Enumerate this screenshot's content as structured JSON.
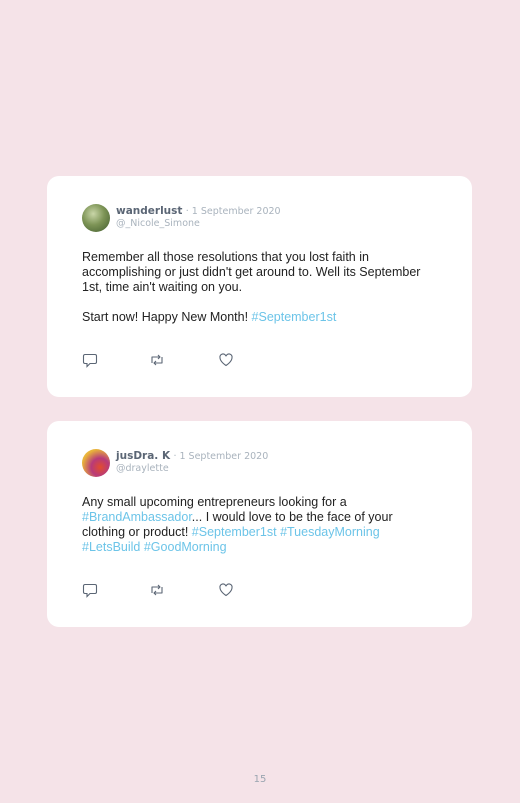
{
  "posts": [
    {
      "name": "wanderlust",
      "date": "· 1 September 2020",
      "handle": "@_Nicole_Simone",
      "paragraph1": "Remember all those resolutions that you lost faith in accomplishing or just didn't get around to. Well its September 1st, time ain't waiting on you.",
      "paragraph2_text": "Start now! Happy New Month! ",
      "paragraph2_tag": "#September1st"
    },
    {
      "name": "jusDra. K",
      "date": "· 1 September 2020",
      "handle": "@draylette",
      "text1": "Any small upcoming entrepreneurs looking for a ",
      "tag1": "#BrandAmbassador",
      "text2": "... I would love to be the face of your clothing or product! ",
      "tag2": "#September1st",
      "tag3": "#TuesdayMorning",
      "tag4": "#LetsBuild",
      "tag5": "#GoodMorning"
    }
  ],
  "icons": {
    "reply": "reply-icon",
    "retweet": "retweet-icon",
    "like": "heart-icon"
  },
  "page_number": "15"
}
